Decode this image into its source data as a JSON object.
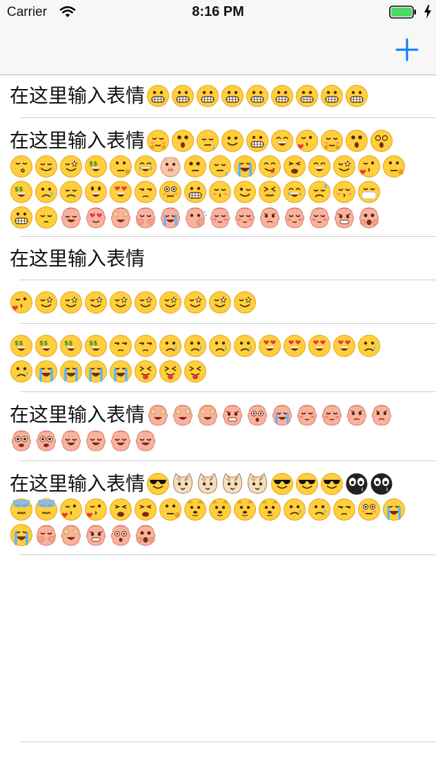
{
  "status_bar": {
    "carrier": "Carrier",
    "time": "8:16 PM"
  },
  "nav": {
    "add_icon": "plus-icon",
    "accent_color": "#0a7aff"
  },
  "cells": [
    {
      "text": "在这里输入表情",
      "rows": [
        [
          "grin",
          "grin",
          "grin",
          "grin",
          "grin",
          "grin",
          "grin",
          "grin",
          "grin"
        ]
      ]
    },
    {
      "text": "在这里输入表情",
      "rows": [
        [
          "shy",
          "surprised",
          "sleepy",
          "smile",
          "grin",
          "laugh",
          "kiss-heart",
          "shy",
          "surprised",
          "dizzy"
        ],
        [
          "whistle",
          "blush",
          "wink-star",
          "money",
          "think",
          "tears-joy",
          "pig",
          "stare",
          "sleepy",
          "cry-loud",
          "yum",
          "tired",
          "laugh",
          "wink-star",
          "kiss-heart",
          "think"
        ],
        [
          "money",
          "sad",
          "disappointed",
          "smiley",
          "heart-eyes",
          "unamused",
          "flushed",
          "grin",
          "kiss",
          "wink",
          "confounded",
          "tears-joy",
          "sweat",
          "kiss",
          "mask"
        ],
        [
          "grin",
          "pensive",
          "pink-grin",
          "pink-heart",
          "pink-star",
          "pink-cover",
          "pink-cry",
          "pink-punch",
          "pink-shy",
          "pink-shy",
          "pink-worry",
          "pink-shy",
          "pink-shy",
          "pink-grumpy",
          "pink-shock"
        ]
      ]
    },
    {
      "text": "在这里输入表情",
      "rows": []
    },
    {
      "text": "",
      "rows": [
        [
          "kiss-heart",
          "wink-star",
          "wink-star",
          "wink-star",
          "wink-star",
          "wink-star",
          "wink-star",
          "wink-star",
          "wink-star",
          "wink-star"
        ]
      ]
    },
    {
      "text": "",
      "rows": [
        [
          "money",
          "money",
          "money",
          "money",
          "unamused",
          "unamused",
          "sad",
          "sad",
          "sad",
          "sad",
          "heart-eyes",
          "heart-eyes",
          "heart-eyes",
          "heart-eyes",
          "sad"
        ],
        [
          "sad",
          "cry-loud",
          "cry-loud",
          "cry-loud",
          "cry-loud",
          "tongue",
          "tongue",
          "tongue"
        ]
      ]
    },
    {
      "text": "在这里输入表情",
      "rows": [
        [
          "pink-star",
          "pink-star",
          "pink-star",
          "pink-grumpy",
          "pink-dizzy",
          "pink-cry",
          "pink-shy",
          "pink-shy",
          "pink-worry",
          "pink-worry"
        ],
        [
          "pink-eyes",
          "pink-eyes",
          "pink-grin",
          "pink-grin",
          "pink-grin",
          "pink-grin"
        ]
      ]
    },
    {
      "text": "在这里输入表情",
      "rows": [
        [
          "cool",
          "cat",
          "cat",
          "cat",
          "cat",
          "cool",
          "cool",
          "cool",
          "panda",
          "panda"
        ],
        [
          "meh",
          "meh",
          "kiss-heart",
          "kiss-heart",
          "tired",
          "tired",
          "think",
          "doge",
          "doge",
          "doge",
          "doge",
          "sad",
          "sad",
          "unamused",
          "flushed",
          "cry-loud"
        ],
        [
          "cry-loud",
          "pink-cover",
          "pink-star",
          "pink-grumpy",
          "pink-dizzy",
          "pink-shock"
        ]
      ]
    }
  ]
}
